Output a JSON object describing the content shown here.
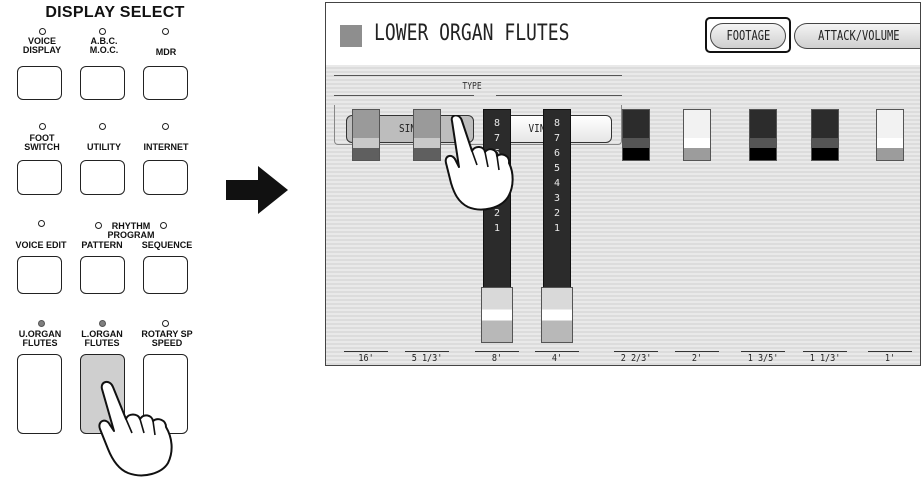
{
  "panel": {
    "title": "DISPLAY SELECT",
    "rows": [
      [
        {
          "label": [
            "VOICE",
            "DISPLAY"
          ],
          "lit": false
        },
        {
          "label": [
            "A.B.C.",
            "M.O.C."
          ],
          "lit": false
        },
        {
          "label": [
            "MDR"
          ],
          "lit": false
        }
      ],
      [
        {
          "label": [
            "FOOT",
            "SWITCH"
          ],
          "lit": false
        },
        {
          "label": [
            "UTILITY"
          ],
          "lit": false
        },
        {
          "label": [
            "INTERNET"
          ],
          "lit": false
        }
      ],
      [
        {
          "label": [
            "VOICE EDIT"
          ],
          "lit": false
        },
        {
          "label": [
            "PATTERN"
          ],
          "lit": false
        },
        {
          "label": [
            "SEQUENCE"
          ],
          "lit": false
        }
      ],
      [
        {
          "label": [
            "U.ORGAN",
            "FLUTES"
          ],
          "lit": true
        },
        {
          "label": [
            "L.ORGAN",
            "FLUTES"
          ],
          "lit": true
        },
        {
          "label": [
            "ROTARY SP",
            "SPEED"
          ],
          "lit": false
        }
      ]
    ],
    "rhythm_program_label": [
      "RHYTHM",
      "PROGRAM"
    ]
  },
  "screen": {
    "title": "LOWER ORGAN FLUTES",
    "tabs": [
      "FOOTAGE",
      "ATTACK/VOLUME"
    ],
    "active_tab": "FOOTAGE",
    "type_label": "TYPE",
    "type_options": [
      "SINE",
      "VINTAGE"
    ],
    "selected_type": "SINE",
    "drawbars": [
      {
        "footage": "16'",
        "color": "gray",
        "value": 0
      },
      {
        "footage": "5 1/3'",
        "color": "gray",
        "value": 0
      },
      {
        "footage": "8'",
        "color": "white",
        "value": 8
      },
      {
        "footage": "4'",
        "color": "white",
        "value": 8
      },
      {
        "footage": "2 2/3'",
        "color": "black",
        "value": 0
      },
      {
        "footage": "2'",
        "color": "white",
        "value": 0
      },
      {
        "footage": "1 3/5'",
        "color": "black",
        "value": 0
      },
      {
        "footage": "1 1/3'",
        "color": "black",
        "value": 0
      },
      {
        "footage": "1'",
        "color": "white",
        "value": 0
      }
    ],
    "drawbar_scale": [
      "8",
      "7",
      "6",
      "5",
      "4",
      "3",
      "2",
      "1"
    ]
  },
  "icons": {
    "arrow": "right-arrow-icon",
    "hand": "pointing-hand-icon"
  },
  "colors": {
    "lit_led": "#7f7f7f",
    "lit_button": "#cfcfcf",
    "selected_type_button": "#bdbdbd",
    "title_square": "#8e8e8e"
  }
}
